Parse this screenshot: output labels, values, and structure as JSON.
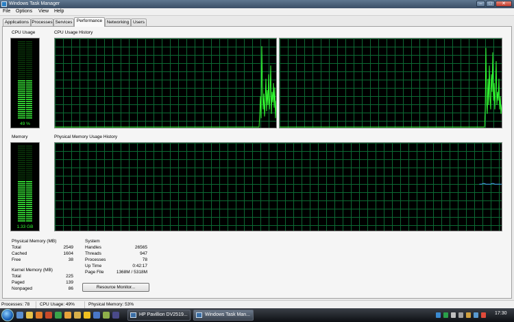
{
  "window": {
    "title": "Windows Task Manager",
    "minimize": "–",
    "maximize": "□",
    "close": "✕"
  },
  "menu": [
    "File",
    "Options",
    "View",
    "Help"
  ],
  "tabs": [
    {
      "label": "Applications",
      "active": false
    },
    {
      "label": "Processes",
      "active": false
    },
    {
      "label": "Services",
      "active": false
    },
    {
      "label": "Performance",
      "active": true
    },
    {
      "label": "Networking",
      "active": false
    },
    {
      "label": "Users",
      "active": false
    }
  ],
  "cpu": {
    "section_label": "CPU Usage",
    "gauge_text": "49 %",
    "usage_fraction": 0.49,
    "history_label": "CPU Usage History",
    "core1_history": [
      0,
      0,
      0,
      0,
      0,
      0,
      0,
      0,
      0,
      0,
      0,
      0,
      0,
      0,
      0,
      0,
      0,
      0,
      0,
      0,
      0,
      0,
      0,
      0,
      0,
      0,
      0,
      0,
      0,
      0,
      0,
      0,
      0,
      0,
      0,
      0,
      0,
      0,
      0,
      0,
      0,
      0,
      0,
      0,
      0,
      0,
      0,
      0,
      0,
      0,
      0,
      0,
      0,
      0,
      0,
      0,
      0,
      0,
      0,
      0,
      0,
      0,
      0,
      0,
      0,
      0,
      0,
      0,
      0,
      0,
      0,
      0,
      0,
      0,
      0,
      0,
      0,
      0,
      0,
      0,
      0,
      0,
      0,
      0,
      0,
      0,
      0,
      0,
      0,
      0,
      0,
      0,
      0,
      0,
      0,
      0,
      0,
      0,
      0,
      0,
      0,
      0,
      0,
      0,
      0,
      0,
      0,
      0,
      0,
      0,
      0,
      0,
      0,
      0,
      0,
      0,
      0,
      0,
      0,
      0,
      0,
      0,
      0,
      0,
      0,
      0,
      0,
      0,
      0,
      0,
      0,
      0,
      0,
      0,
      0,
      0,
      0,
      0,
      0,
      0,
      0,
      0,
      0,
      0,
      0,
      0,
      0,
      0,
      0,
      0,
      0,
      0,
      0,
      0,
      0,
      0,
      0,
      0,
      0,
      0,
      0,
      0,
      0,
      0,
      0,
      0,
      0,
      0,
      0,
      0,
      0,
      0,
      0,
      0,
      0,
      0,
      0,
      0,
      0,
      0,
      0,
      0,
      0,
      0,
      0,
      0,
      0,
      0,
      0,
      0,
      0,
      0,
      0,
      0,
      0,
      0,
      0,
      0,
      0,
      0,
      0,
      0,
      0,
      0,
      0,
      0,
      0,
      0,
      0,
      0,
      0,
      0,
      0,
      0,
      0,
      0,
      0,
      0,
      0,
      0,
      0,
      0,
      0,
      0,
      0,
      0,
      0,
      0,
      0,
      0,
      0,
      0,
      0,
      0,
      0,
      0,
      0,
      0,
      0,
      0,
      0,
      0,
      0,
      0,
      0,
      0,
      0,
      0,
      0,
      0,
      0,
      0,
      0,
      0,
      0,
      0,
      0,
      0,
      0,
      0,
      0,
      0,
      0,
      0,
      0,
      0,
      0,
      0,
      0,
      0,
      0,
      0,
      0,
      0,
      0,
      0,
      0,
      0,
      0,
      0,
      0,
      0,
      0,
      0,
      0,
      0,
      0,
      0,
      0,
      0,
      0,
      0,
      0,
      0,
      0,
      0,
      0,
      0,
      0,
      0.15,
      0.35,
      0.1,
      0.92,
      0.45,
      0.2,
      0.38,
      0.12,
      0.3,
      0.55,
      0.18,
      0.42,
      0.25,
      0.6,
      0.2,
      0.35,
      0.7,
      0.15,
      0.4,
      0.28,
      0.5,
      0.22,
      0.45,
      0.1,
      0.3
    ],
    "core2_history": [
      0,
      0,
      0,
      0,
      0,
      0,
      0,
      0,
      0,
      0,
      0,
      0,
      0,
      0,
      0,
      0,
      0,
      0,
      0,
      0,
      0,
      0,
      0,
      0,
      0,
      0,
      0,
      0,
      0,
      0,
      0,
      0,
      0,
      0,
      0,
      0,
      0,
      0,
      0,
      0,
      0,
      0,
      0,
      0,
      0,
      0,
      0,
      0,
      0,
      0,
      0,
      0,
      0,
      0,
      0,
      0,
      0,
      0,
      0,
      0,
      0,
      0,
      0,
      0,
      0,
      0,
      0,
      0,
      0,
      0,
      0,
      0,
      0,
      0,
      0,
      0,
      0,
      0,
      0,
      0,
      0,
      0,
      0,
      0,
      0,
      0,
      0,
      0,
      0,
      0,
      0,
      0,
      0,
      0,
      0,
      0,
      0,
      0,
      0,
      0,
      0,
      0,
      0,
      0,
      0,
      0,
      0,
      0,
      0,
      0,
      0,
      0,
      0,
      0,
      0,
      0,
      0,
      0,
      0,
      0,
      0,
      0,
      0,
      0,
      0,
      0,
      0,
      0,
      0,
      0,
      0,
      0,
      0,
      0,
      0,
      0,
      0,
      0,
      0,
      0,
      0,
      0,
      0,
      0,
      0,
      0,
      0,
      0,
      0,
      0,
      0,
      0,
      0,
      0,
      0,
      0,
      0,
      0,
      0,
      0,
      0,
      0,
      0,
      0,
      0,
      0,
      0,
      0,
      0,
      0,
      0,
      0,
      0,
      0,
      0,
      0,
      0,
      0,
      0,
      0,
      0,
      0,
      0,
      0,
      0,
      0,
      0,
      0,
      0,
      0,
      0,
      0,
      0,
      0,
      0,
      0,
      0,
      0,
      0,
      0,
      0,
      0,
      0,
      0,
      0,
      0,
      0,
      0,
      0,
      0,
      0,
      0,
      0,
      0,
      0,
      0,
      0,
      0,
      0,
      0,
      0,
      0,
      0,
      0,
      0,
      0,
      0,
      0,
      0,
      0,
      0,
      0,
      0,
      0,
      0,
      0,
      0,
      0,
      0,
      0,
      0,
      0,
      0,
      0,
      0,
      0,
      0,
      0,
      0,
      0,
      0,
      0,
      0,
      0,
      0,
      0,
      0,
      0,
      0,
      0,
      0,
      0,
      0,
      0,
      0,
      0,
      0,
      0,
      0,
      0,
      0,
      0,
      0,
      0,
      0,
      0,
      0,
      0,
      0,
      0,
      0,
      0,
      0,
      0,
      0,
      0,
      0,
      0,
      0,
      0,
      0,
      0,
      0,
      0,
      0,
      0,
      0,
      0,
      0,
      0,
      0.2,
      0.9,
      0.3,
      0.15,
      0.55,
      0.25,
      0.7,
      0.35,
      0.2,
      0.6,
      0.4,
      0.85,
      0.3,
      0.5,
      0.2,
      0.45,
      0.75,
      0.25,
      0.4,
      0.3,
      0.55,
      0.2,
      0.35,
      0.15,
      0.25
    ]
  },
  "memory": {
    "section_label": "Memory",
    "gauge_text": "1.33 GB",
    "usage_fraction": 0.53,
    "history_label": "Physical Memory Usage History",
    "history": [
      0.53,
      0.53,
      0.54,
      0.53,
      0.53,
      0.53,
      0.54,
      0.53,
      0.53,
      0.53,
      0.53
    ]
  },
  "physical_memory": {
    "header": "Physical Memory (MB)",
    "rows": [
      {
        "k": "Total",
        "v": "2549"
      },
      {
        "k": "Cached",
        "v": "1604"
      },
      {
        "k": "Free",
        "v": "38"
      }
    ]
  },
  "kernel_memory": {
    "header": "Kernel Memory (MB)",
    "rows": [
      {
        "k": "Total",
        "v": "225"
      },
      {
        "k": "Paged",
        "v": "139"
      },
      {
        "k": "Nonpaged",
        "v": "86"
      }
    ]
  },
  "system": {
    "header": "System",
    "rows": [
      {
        "k": "Handles",
        "v": "26565"
      },
      {
        "k": "Threads",
        "v": "947"
      },
      {
        "k": "Processes",
        "v": "78"
      },
      {
        "k": "Up Time",
        "v": "0:42:17"
      },
      {
        "k": "Page File",
        "v": "1368M / 5318M"
      }
    ]
  },
  "resource_monitor_button": "Resource Monitor...",
  "status": {
    "processes": "Processes: 78",
    "cpu": "CPU Usage: 49%",
    "memory": "Physical Memory: 53%"
  },
  "taskbar": {
    "buttons": [
      {
        "label": "HP Pavillion DV2519...",
        "active": false
      },
      {
        "label": "Windows Task Man...",
        "active": true
      }
    ],
    "clock": "17:30",
    "colors": {
      "accent_green": "#33ff33",
      "grid_green": "#0c6b34"
    }
  }
}
